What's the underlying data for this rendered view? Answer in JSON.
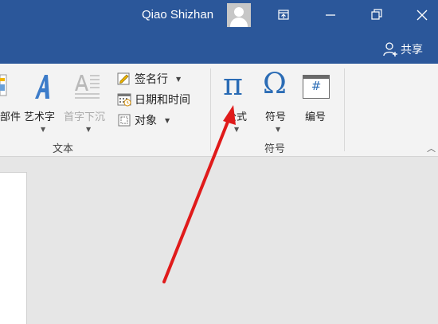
{
  "titlebar": {
    "user_name": "Qiao Shizhan",
    "share_label": "共享"
  },
  "ribbon": {
    "insert_group": {
      "parts_label": "部件",
      "wordart_label": "艺术字",
      "dropcap_label": "首字下沉",
      "signature_label": "签名行",
      "datetime_label": "日期和时间",
      "object_label": "对象",
      "group_name": "文本"
    },
    "symbols_group": {
      "equation_label": "公式",
      "symbol_label": "符号",
      "number_label": "编号",
      "group_name": "符号",
      "equation_glyph": "π",
      "symbol_glyph": "Ω",
      "number_glyph": "#"
    }
  },
  "colors": {
    "titlebar_bg": "#2b579a",
    "accent_blue": "#2b6cb5",
    "annotation_red": "#e01b1b"
  }
}
